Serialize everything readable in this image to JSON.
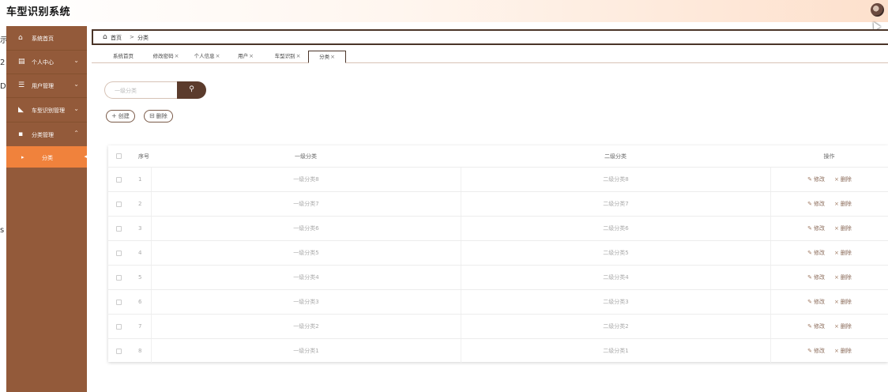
{
  "app": {
    "title": "车型识别系统"
  },
  "edge_chars": [
    "示",
    "2",
    "D",
    "s"
  ],
  "sidebar": {
    "items": [
      {
        "label": "系统首页",
        "icon": "home-icon",
        "glyph": "⌂"
      },
      {
        "label": "个人中心",
        "icon": "id-card-icon",
        "glyph": "▤",
        "caret": "⌄"
      },
      {
        "label": "用户管理",
        "icon": "sliders-icon",
        "glyph": "☰",
        "caret": "⌄"
      },
      {
        "label": "车型识别管理",
        "icon": "car-icon",
        "glyph": "◣",
        "caret": "⌄"
      },
      {
        "label": "分类管理",
        "icon": "grid-icon",
        "glyph": "▪",
        "caret": "⌃"
      },
      {
        "label": "分类",
        "icon": "caret-right-icon",
        "glyph": "▸",
        "caret": "◂"
      }
    ]
  },
  "breadcrumb": {
    "home": "首页",
    "separator": ">",
    "current": "分类"
  },
  "tabs": [
    {
      "label": "系统首页",
      "close": ""
    },
    {
      "label": "修改密码",
      "close": "×"
    },
    {
      "label": "个人信息",
      "close": "×"
    },
    {
      "label": "用户",
      "close": "×"
    },
    {
      "label": "车型识别",
      "close": "×"
    },
    {
      "label": "分类",
      "close": "×"
    }
  ],
  "search": {
    "placeholder": "一级分类",
    "button_icon": "⚲"
  },
  "actions": {
    "create": "创建",
    "create_icon": "+",
    "delete": "删除",
    "delete_icon": "⊟"
  },
  "table": {
    "headers": {
      "index": "序号",
      "col1": "一级分类",
      "col2": "二级分类",
      "ops": "操作"
    },
    "rows": [
      {
        "index": "1",
        "col1": "一级分类8",
        "col2": "二级分类8"
      },
      {
        "index": "2",
        "col1": "一级分类7",
        "col2": "二级分类7"
      },
      {
        "index": "3",
        "col1": "一级分类6",
        "col2": "二级分类6"
      },
      {
        "index": "4",
        "col1": "一级分类5",
        "col2": "二级分类5"
      },
      {
        "index": "5",
        "col1": "一级分类4",
        "col2": "二级分类4"
      },
      {
        "index": "6",
        "col1": "一级分类3",
        "col2": "二级分类3"
      },
      {
        "index": "7",
        "col1": "一级分类2",
        "col2": "二级分类2"
      },
      {
        "index": "8",
        "col1": "一级分类1",
        "col2": "二级分类1"
      }
    ],
    "edit_label": "修改",
    "edit_icon": "✎",
    "delete_label": "删除",
    "delete_icon": "×"
  },
  "colors": {
    "sidebar": "#935a3a",
    "active": "#f0823c",
    "accent": "#5b3b2c"
  }
}
